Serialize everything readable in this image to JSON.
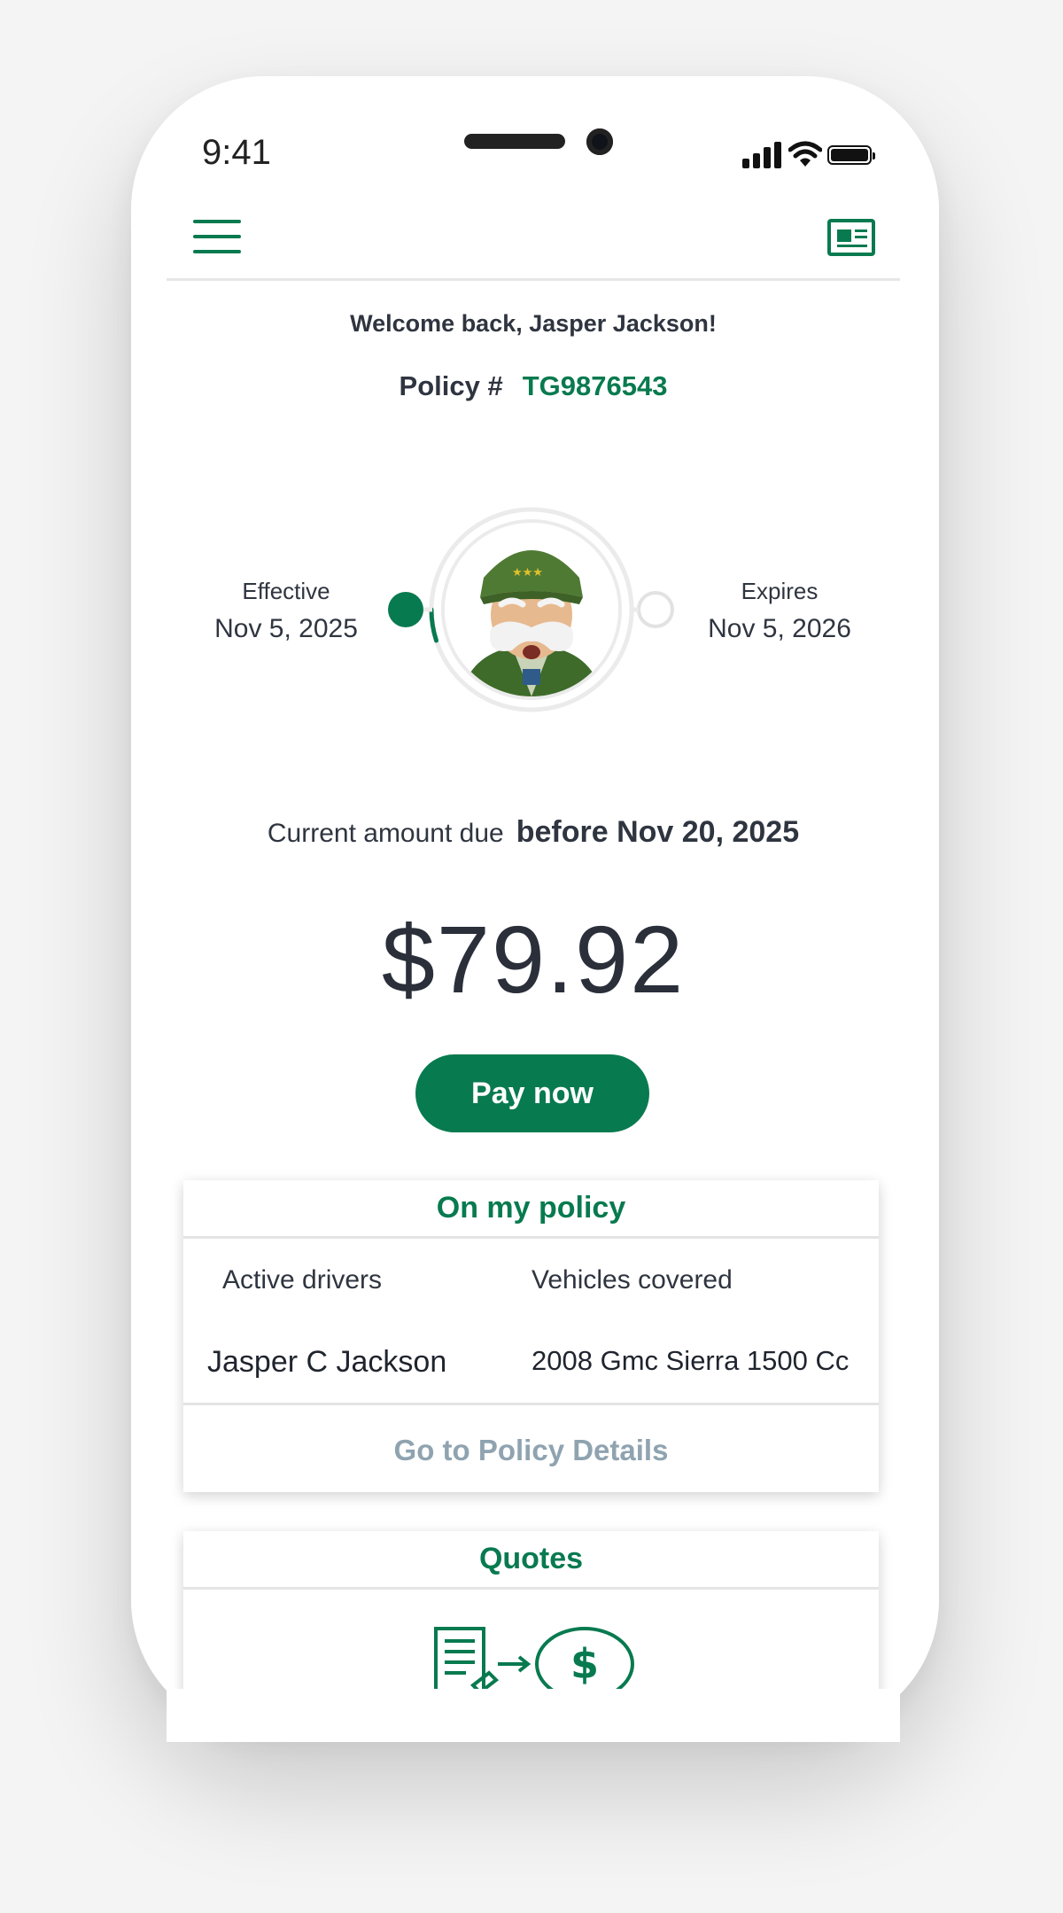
{
  "status_bar": {
    "time": "9:41"
  },
  "header": {
    "menu_icon": "hamburger-menu-icon",
    "card_icon": "id-card-icon"
  },
  "greeting": "Welcome back, Jasper Jackson!",
  "policy": {
    "label": "Policy #",
    "number": "TG9876543"
  },
  "term": {
    "effective_label": "Effective",
    "effective_date": "Nov 5, 2025",
    "expires_label": "Expires",
    "expires_date": "Nov 5, 2026",
    "progress_fraction": 0.05
  },
  "payment": {
    "due_label": "Current amount due",
    "due_date_text": "before Nov 20, 2025",
    "amount": "$79.92",
    "pay_button": "Pay now"
  },
  "on_my_policy": {
    "title": "On my policy",
    "drivers_header": "Active drivers",
    "vehicles_header": "Vehicles covered",
    "driver": "Jasper C Jackson",
    "vehicle": "2008 Gmc Sierra 1500 Cc",
    "details_link": "Go to Policy Details"
  },
  "quotes": {
    "title": "Quotes",
    "icon": "quote-to-dollar-icon"
  },
  "colors": {
    "brand_green": "#087a4f",
    "link_gray": "#8fa3b0",
    "text": "#2f3540"
  }
}
